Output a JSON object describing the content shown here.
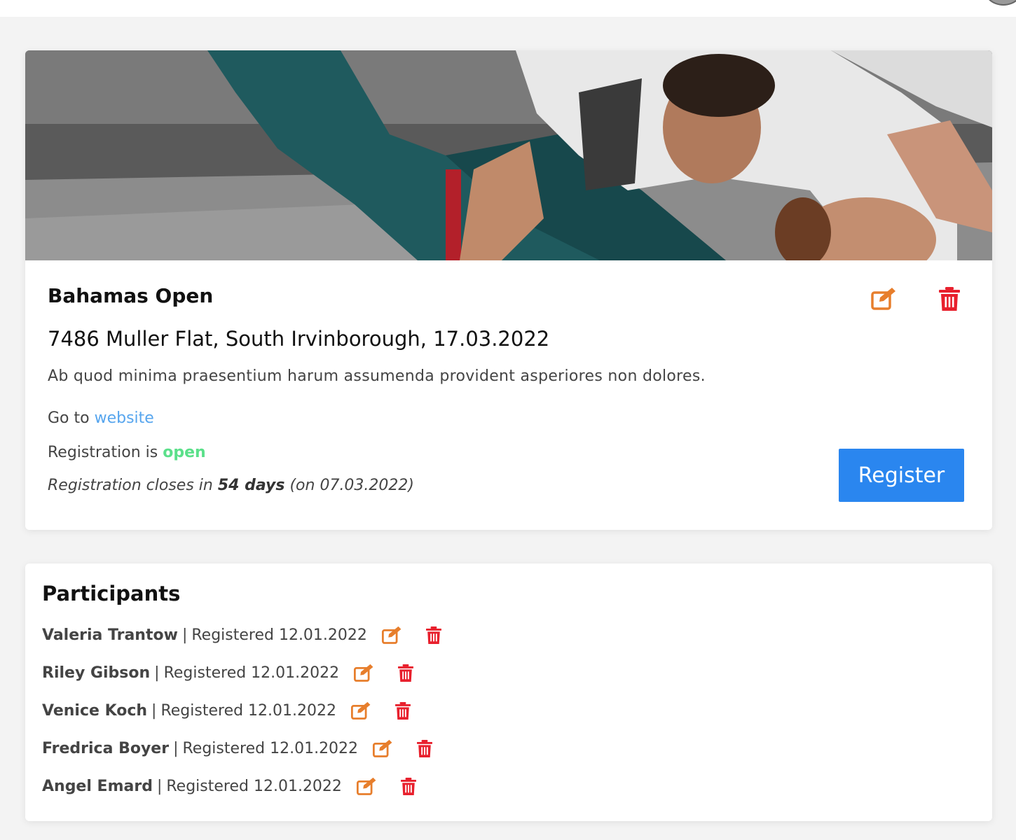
{
  "event": {
    "title": "Bahamas Open",
    "subtitle": "7486 Muller Flat, South Irvinborough, 17.03.2022",
    "description": "Ab quod minima praesentium harum assumenda provident asperiores non dolores.",
    "goto_prefix": "Go to",
    "website_link": "website",
    "registration_prefix": "Registration is",
    "registration_status": "open",
    "closes_prefix": "Registration closes in",
    "closes_days": "54 days",
    "closes_suffix": "(on 07.03.2022)",
    "register_label": "Register",
    "edit_icon": "edit-icon",
    "delete_icon": "trash-icon"
  },
  "participants": {
    "title": "Participants",
    "separator": "|",
    "items": [
      {
        "name": "Valeria Trantow",
        "registered": "Registered 12.01.2022"
      },
      {
        "name": "Riley Gibson",
        "registered": "Registered 12.01.2022"
      },
      {
        "name": "Venice Koch",
        "registered": "Registered 12.01.2022"
      },
      {
        "name": "Fredrica Boyer",
        "registered": "Registered 12.01.2022"
      },
      {
        "name": "Angel Emard",
        "registered": "Registered 12.01.2022"
      }
    ]
  },
  "colors": {
    "accent_blue": "#2a86ef",
    "link_blue": "#56a5ee",
    "status_green": "#5be08a",
    "edit_orange": "#e77e2c",
    "delete_red": "#e8202d"
  }
}
